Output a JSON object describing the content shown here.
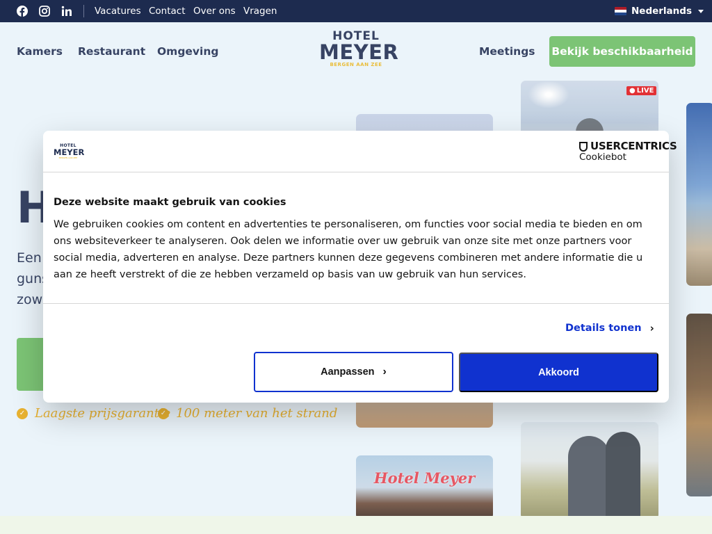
{
  "topbar": {
    "links": [
      "Vacatures",
      "Contact",
      "Over ons",
      "Vragen"
    ],
    "language": "Nederlands",
    "social_icons": [
      "facebook-icon",
      "instagram-icon",
      "linkedin-icon"
    ]
  },
  "header": {
    "nav_left": [
      "Kamers",
      "Restaurant",
      "Omgeving"
    ],
    "nav_right": "Meetings",
    "cta": "Bekijk beschikbaarheid",
    "logo": {
      "line1": "HOTEL",
      "line2": "MEYER",
      "line3": "BERGEN AAN ZEE"
    }
  },
  "hero": {
    "heading": "H",
    "lines": [
      "Een",
      "guns",
      "zowe"
    ],
    "usps": [
      "Laagste prijsgarantie",
      "100 meter van het strand"
    ],
    "live_badge": "LIVE",
    "sign_text": "Hotel Meyer"
  },
  "cookie_modal": {
    "logo": {
      "line1": "HOTEL",
      "line2": "MEYER",
      "line3": "BERGEN AAN ZEE"
    },
    "brand": "USERCENTRICS",
    "brand_sub": "Cookiebot",
    "title": "Deze website maakt gebruik van cookies",
    "body": "We gebruiken cookies om content en advertenties te personaliseren, om functies voor social media te bieden en om ons websiteverkeer te analyseren. Ook delen we informatie over uw gebruik van onze site met onze partners voor social media, adverteren en analyse. Deze partners kunnen deze gegevens combineren met andere informatie die u aan ze heeft verstrekt of die ze hebben verzameld op basis van uw gebruik van hun services.",
    "details_link": "Details tonen",
    "customize_button": "Aanpassen",
    "accept_button": "Akkoord"
  },
  "colors": {
    "navy": "#1d2b4f",
    "green": "#6cbe63",
    "gold": "#e6a916",
    "cookie_blue": "#1032cf"
  }
}
